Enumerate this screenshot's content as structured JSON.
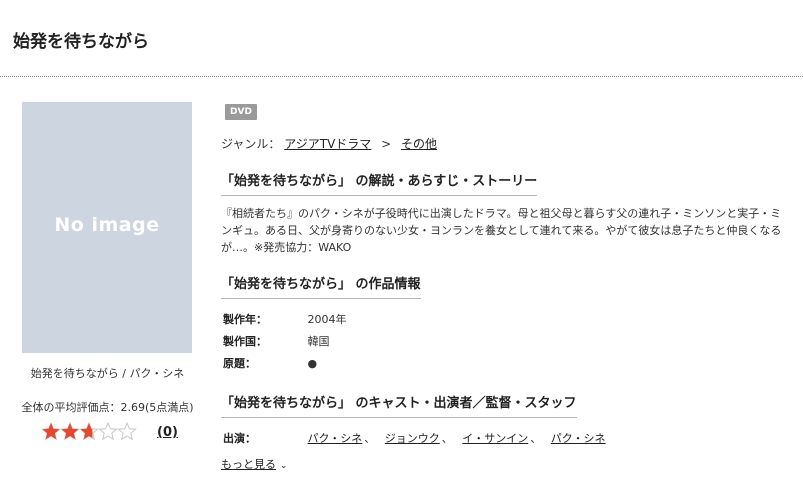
{
  "page": {
    "title": "始発を待ちながら"
  },
  "poster": {
    "placeholder_text": "No image",
    "caption": "始発を待ちながら / パク・シネ"
  },
  "rating": {
    "average_text": "全体の平均評価点：2.69(5点満点)",
    "value": 2.69,
    "max": 5,
    "count_label": "(0)"
  },
  "badge": {
    "label": "DVD"
  },
  "genre": {
    "label": "ジャンル：",
    "items": [
      "アジアTVドラマ",
      "その他"
    ],
    "separator": ">"
  },
  "sections": {
    "story": {
      "heading": "「始発を待ちながら」 の解説・あらすじ・ストーリー"
    },
    "info": {
      "heading": "「始発を待ちながら」 の作品情報"
    },
    "cast": {
      "heading": "「始発を待ちながら」 のキャスト・出演者／監督・スタッフ"
    }
  },
  "story": {
    "lines": [
      "『相続者たち』のパク・シネが子役時代に出演したドラマ。母と祖父母と暮らす父の連れ子・ミンソンと実子・ミ",
      "ンギュ。ある日、父が身寄りのない少女・ヨンランを養女として連れて来る。やがて彼女は息子たちと仲良くなる",
      "が…。※発売協力：WAKO"
    ]
  },
  "info": {
    "year_label": "製作年：",
    "year_value": "2004年",
    "country_label": "製作国：",
    "country_value": "韓国",
    "original_label": "原題：",
    "original_value": "●"
  },
  "cast": {
    "label": "出演：",
    "members": [
      "パク・シネ",
      "ジョンウク",
      "イ・サンイン",
      "パク・シネ"
    ],
    "separator": "、",
    "more_label": "もっと見る"
  },
  "colors": {
    "star_filled": "#e8472e",
    "star_empty": "#c8c8c8",
    "poster_bg": "#ccd5e0"
  }
}
